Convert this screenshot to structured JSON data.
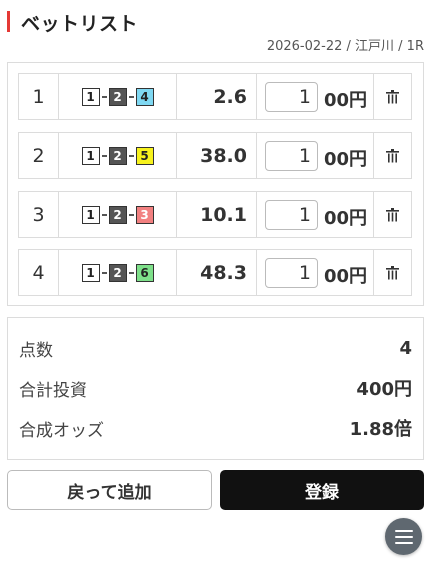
{
  "header": {
    "title": "ベットリスト",
    "meta": "2026-02-22 / 江戸川 / 1R"
  },
  "bets": [
    {
      "no": "1",
      "combo": [
        "1",
        "2",
        "4"
      ],
      "third_color": "#7fd8f2",
      "odds": "2.6",
      "amount": "1",
      "unit": "00円"
    },
    {
      "no": "2",
      "combo": [
        "1",
        "2",
        "5"
      ],
      "third_color": "#f7f21d",
      "odds": "38.0",
      "amount": "1",
      "unit": "00円"
    },
    {
      "no": "3",
      "combo": [
        "1",
        "2",
        "3"
      ],
      "third_color": "#f28080",
      "odds": "10.1",
      "amount": "1",
      "unit": "00円"
    },
    {
      "no": "4",
      "combo": [
        "1",
        "2",
        "6"
      ],
      "third_color": "#7ee08a",
      "odds": "48.3",
      "amount": "1",
      "unit": "00円"
    }
  ],
  "summary": {
    "count_label": "点数",
    "count_value": "4",
    "total_label": "合計投資",
    "total_value": "400円",
    "odds_label": "合成オッズ",
    "odds_value": "1.88倍"
  },
  "buttons": {
    "back": "戻って追加",
    "register": "登録"
  },
  "colors": {
    "accent": "#e53935",
    "box1": "#ffffff",
    "box2": "#555555"
  }
}
